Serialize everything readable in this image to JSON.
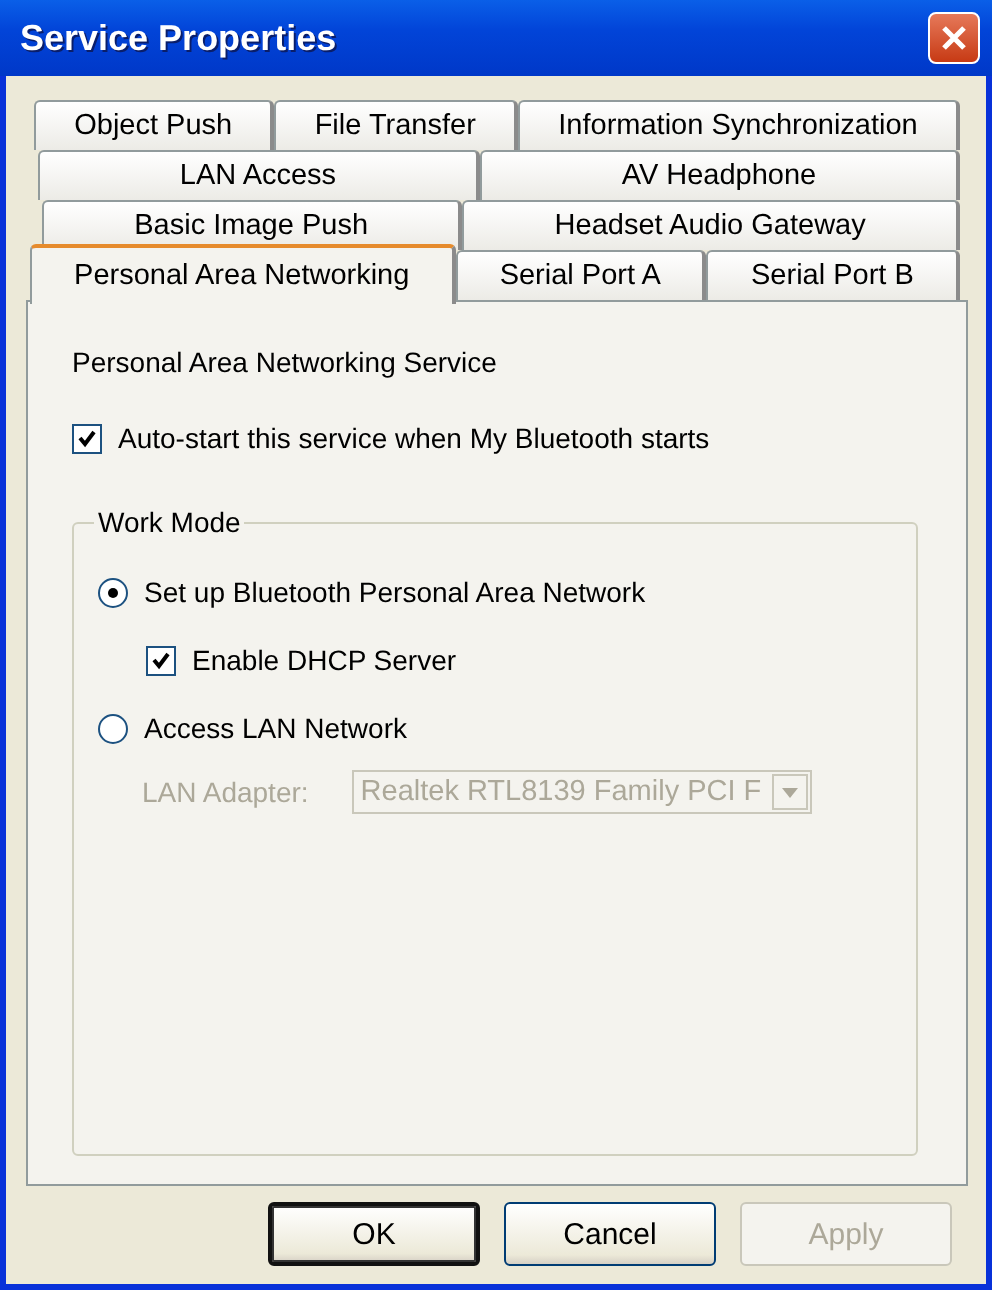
{
  "window": {
    "title": "Service Properties"
  },
  "tab_rows": [
    [
      {
        "label": "Object Push",
        "selected": false
      },
      {
        "label": "File Transfer",
        "selected": false
      },
      {
        "label": "Information Synchronization",
        "selected": false
      }
    ],
    [
      {
        "label": "LAN Access",
        "selected": false
      },
      {
        "label": "AV Headphone",
        "selected": false
      }
    ],
    [
      {
        "label": "Basic Image Push",
        "selected": false
      },
      {
        "label": "Headset Audio Gateway",
        "selected": false
      }
    ],
    [
      {
        "label": "Personal Area Networking",
        "selected": true
      },
      {
        "label": "Serial Port A",
        "selected": false
      },
      {
        "label": "Serial Port B",
        "selected": false
      }
    ]
  ],
  "panel": {
    "heading": "Personal Area Networking Service",
    "autostart": {
      "label": "Auto-start this service when My Bluetooth starts",
      "checked": true
    },
    "work_mode": {
      "title": "Work Mode",
      "options": [
        {
          "label": "Set up Bluetooth Personal Area Network",
          "selected": true
        },
        {
          "label": "Access LAN Network",
          "selected": false
        }
      ],
      "dhcp": {
        "label": "Enable DHCP Server",
        "checked": true
      },
      "lan_adapter": {
        "label": "LAN Adapter:",
        "value": "Realtek RTL8139 Family PCI F",
        "disabled": true
      }
    }
  },
  "buttons": [
    {
      "label": "OK",
      "default": true,
      "disabled": false
    },
    {
      "label": "Cancel",
      "default": false,
      "disabled": false
    },
    {
      "label": "Apply",
      "default": false,
      "disabled": true
    }
  ]
}
